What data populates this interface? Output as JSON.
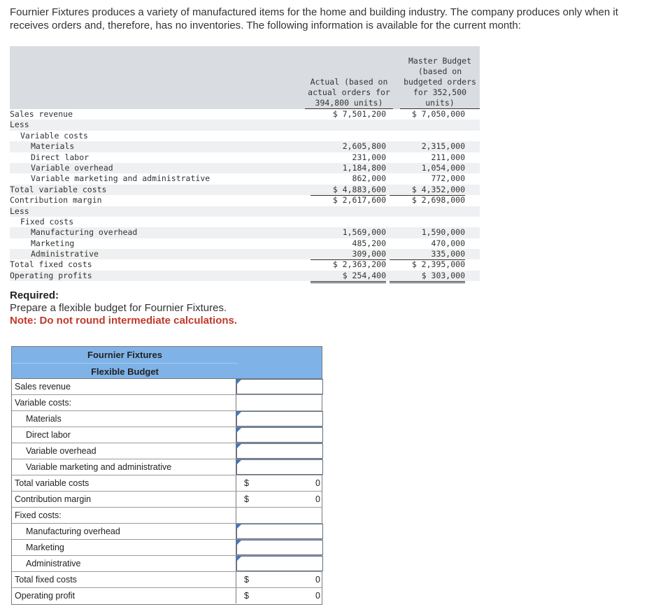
{
  "intro": "Fournier Fixtures produces a variety of manufactured items for the home and building industry. The company produces only when it receives orders and, therefore, has no inventories. The following information is available for the current month:",
  "table": {
    "header_actual": [
      "Actual (based on",
      "actual orders for",
      "394,800 units)"
    ],
    "header_master": [
      "Master Budget",
      "(based on",
      "budgeted orders",
      "for 352,500",
      "units)"
    ],
    "rows": [
      {
        "label": "Sales revenue",
        "indent": 0,
        "actual": "$ 7,501,200",
        "master": "$ 7,050,000",
        "shade": false,
        "line": "ul"
      },
      {
        "label": "Less",
        "indent": 0,
        "actual": "",
        "master": "",
        "shade": true,
        "line": ""
      },
      {
        "label": "Variable costs",
        "indent": 1,
        "actual": "",
        "master": "",
        "shade": false,
        "line": ""
      },
      {
        "label": "Materials",
        "indent": 2,
        "actual": "2,605,800",
        "master": "2,315,000",
        "shade": true,
        "line": ""
      },
      {
        "label": "Direct labor",
        "indent": 2,
        "actual": "231,000",
        "master": "211,000",
        "shade": false,
        "line": ""
      },
      {
        "label": "Variable overhead",
        "indent": 2,
        "actual": "1,184,800",
        "master": "1,054,000",
        "shade": true,
        "line": ""
      },
      {
        "label": "Variable marketing and administrative",
        "indent": 2,
        "actual": "862,000",
        "master": "772,000",
        "shade": false,
        "line": "ul"
      },
      {
        "label": "Total variable costs",
        "indent": 0,
        "actual": "$ 4,883,600",
        "master": "$ 4,352,000",
        "shade": true,
        "line": "ul"
      },
      {
        "label": "Contribution margin",
        "indent": 0,
        "actual": "$ 2,617,600",
        "master": "$ 2,698,000",
        "shade": false,
        "line": ""
      },
      {
        "label": "Less",
        "indent": 0,
        "actual": "",
        "master": "",
        "shade": true,
        "line": ""
      },
      {
        "label": "Fixed costs",
        "indent": 1,
        "actual": "",
        "master": "",
        "shade": false,
        "line": ""
      },
      {
        "label": "Manufacturing overhead",
        "indent": 2,
        "actual": "1,569,000",
        "master": "1,590,000",
        "shade": true,
        "line": ""
      },
      {
        "label": "Marketing",
        "indent": 2,
        "actual": "485,200",
        "master": "470,000",
        "shade": false,
        "line": ""
      },
      {
        "label": "Administrative",
        "indent": 2,
        "actual": "309,000",
        "master": "335,000",
        "shade": true,
        "line": "ul"
      },
      {
        "label": "Total fixed costs",
        "indent": 0,
        "actual": "$ 2,363,200",
        "master": "$ 2,395,000",
        "shade": false,
        "line": "ul"
      },
      {
        "label": "Operating profits",
        "indent": 0,
        "actual": "$ 254,400",
        "master": "$ 303,000",
        "shade": true,
        "line": "dul"
      }
    ]
  },
  "required": {
    "heading": "Required:",
    "text": "Prepare a flexible budget for Fournier Fixtures.",
    "note": "Note: Do not round intermediate calculations."
  },
  "answer": {
    "title1": "Fournier Fixtures",
    "title2": "Flexible Budget",
    "rows": [
      {
        "label": "Sales revenue",
        "indent": false,
        "kind": "input"
      },
      {
        "label": "Variable costs:",
        "indent": false,
        "kind": "none"
      },
      {
        "label": "Materials",
        "indent": true,
        "kind": "input"
      },
      {
        "label": "Direct labor",
        "indent": true,
        "kind": "input"
      },
      {
        "label": "Variable overhead",
        "indent": true,
        "kind": "input"
      },
      {
        "label": "Variable marketing and administrative",
        "indent": true,
        "kind": "input"
      },
      {
        "label": "Total variable costs",
        "indent": false,
        "kind": "calc",
        "dollar": "$",
        "value": "0"
      },
      {
        "label": "Contribution margin",
        "indent": false,
        "kind": "calc",
        "dollar": "$",
        "value": "0"
      },
      {
        "label": "Fixed costs:",
        "indent": false,
        "kind": "none"
      },
      {
        "label": "Manufacturing overhead",
        "indent": true,
        "kind": "input"
      },
      {
        "label": "Marketing",
        "indent": true,
        "kind": "input"
      },
      {
        "label": "Administrative",
        "indent": true,
        "kind": "input"
      },
      {
        "label": "Total fixed costs",
        "indent": false,
        "kind": "calc",
        "dollar": "$",
        "value": "0"
      },
      {
        "label": "Operating profit",
        "indent": false,
        "kind": "calc",
        "dollar": "$",
        "value": "0"
      }
    ]
  }
}
